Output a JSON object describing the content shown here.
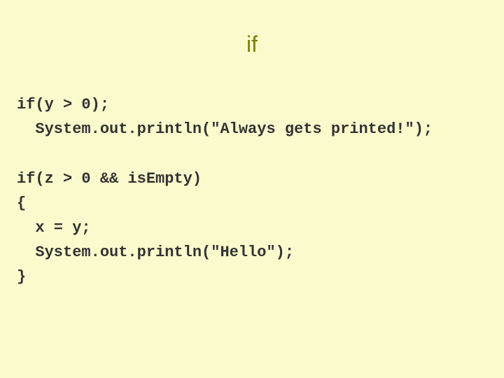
{
  "slide": {
    "title": "if",
    "code_lines": {
      "l1": "if(y > 0);",
      "l2": "  System.out.println(\"Always gets printed!\");",
      "l3": "",
      "l4": "if(z > 0 && isEmpty)",
      "l5": "{",
      "l6": "  x = y;",
      "l7": "  System.out.println(\"Hello\");",
      "l8": "}"
    }
  }
}
